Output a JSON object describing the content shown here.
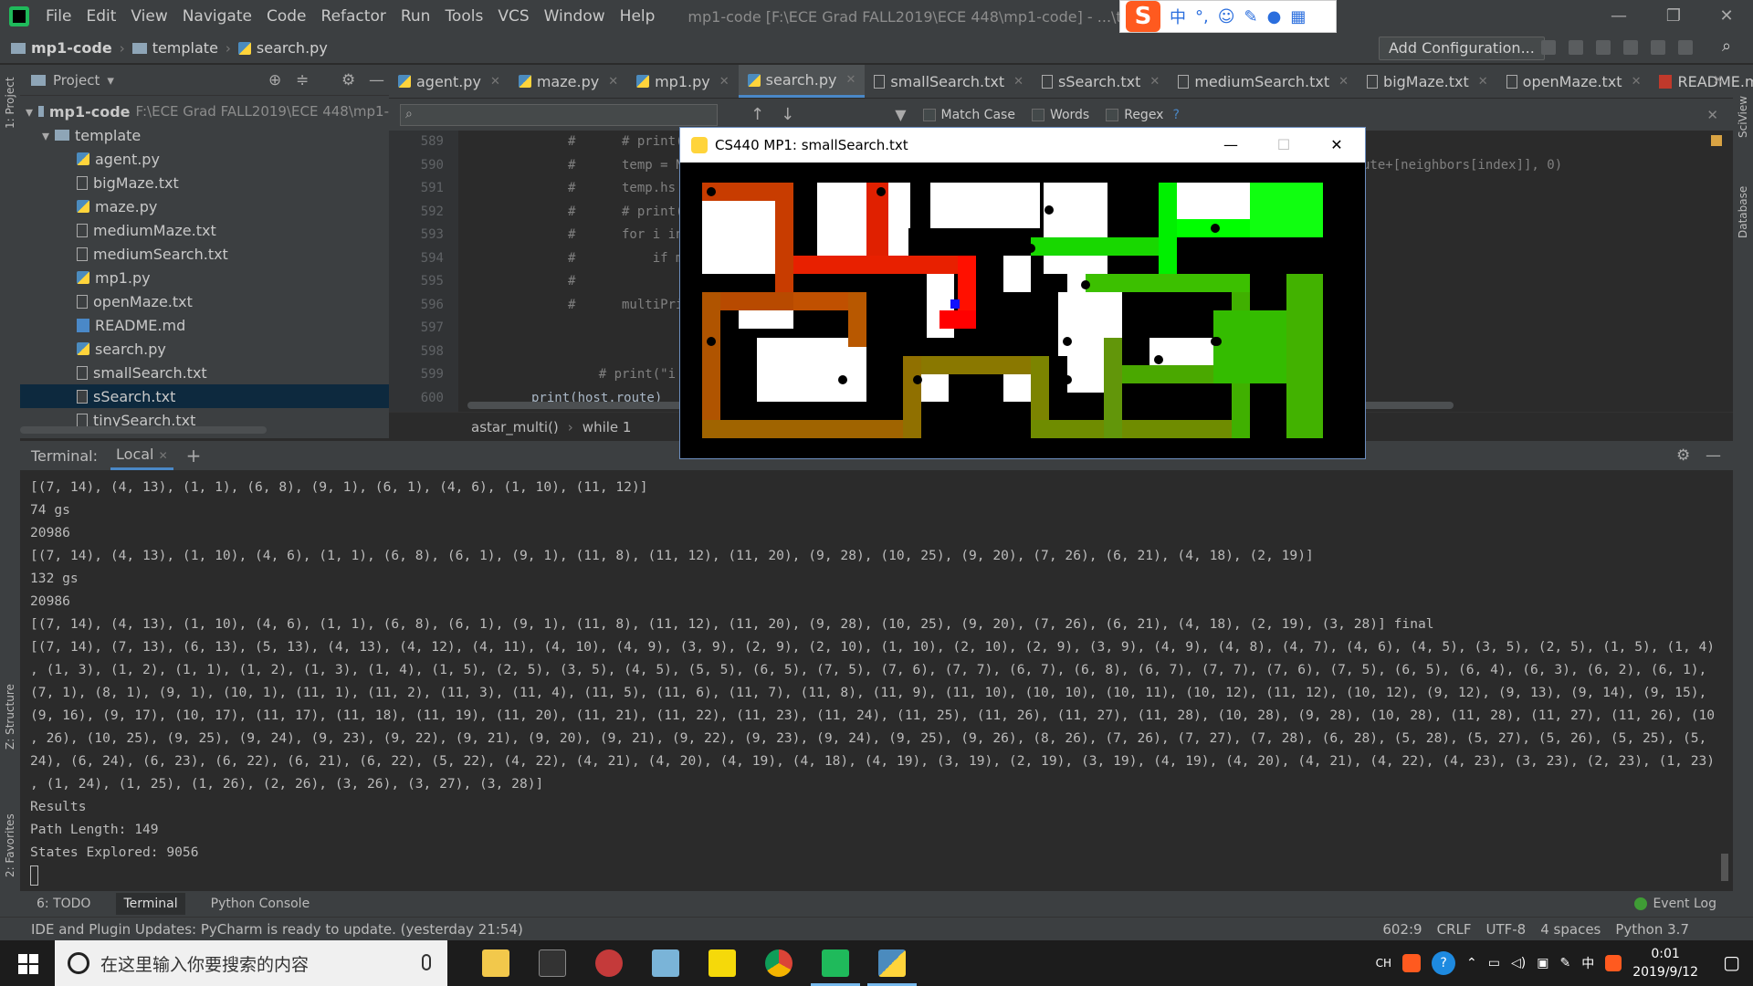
{
  "app": {
    "menu": [
      "File",
      "Edit",
      "View",
      "Navigate",
      "Code",
      "Refactor",
      "Run",
      "Tools",
      "VCS",
      "Window",
      "Help"
    ],
    "window_title": "mp1-code [F:\\ECE Grad FALL2019\\ECE 448\\mp1-code] - ...\\template\\sear"
  },
  "ime": {
    "logo": "S",
    "mode": "中"
  },
  "navbar": {
    "crumbs": [
      "mp1-code",
      "template",
      "search.py"
    ],
    "add_config": "Add Configuration..."
  },
  "project": {
    "title": "Project",
    "root_name": "mp1-code",
    "root_path": "F:\\ECE Grad FALL2019\\ECE 448\\mp1-",
    "folder": "template",
    "files": [
      {
        "name": "agent.py",
        "type": "py"
      },
      {
        "name": "bigMaze.txt",
        "type": "txt"
      },
      {
        "name": "maze.py",
        "type": "py"
      },
      {
        "name": "mediumMaze.txt",
        "type": "txt"
      },
      {
        "name": "mediumSearch.txt",
        "type": "txt"
      },
      {
        "name": "mp1.py",
        "type": "py"
      },
      {
        "name": "openMaze.txt",
        "type": "txt"
      },
      {
        "name": "README.md",
        "type": "md"
      },
      {
        "name": "search.py",
        "type": "py"
      },
      {
        "name": "smallSearch.txt",
        "type": "txt"
      },
      {
        "name": "sSearch.txt",
        "type": "txt",
        "selected": true
      },
      {
        "name": "tinySearch.txt",
        "type": "txt"
      }
    ]
  },
  "tabs": [
    "agent.py",
    "maze.py",
    "mp1.py",
    "search.py",
    "smallSearch.txt",
    "sSearch.txt",
    "mediumSearch.txt",
    "bigMaze.txt",
    "openMaze.txt",
    "README.md"
  ],
  "active_tab": "search.py",
  "find": {
    "match_case": "Match Case",
    "words": "Words",
    "regex": "Regex",
    "help": "?"
  },
  "code": {
    "lines": [
      {
        "n": "589",
        "text": "#      # print("
      },
      {
        "n": "590",
        "text": "#      temp = N"
      },
      {
        "n": "591",
        "text": "#      temp.hs"
      },
      {
        "n": "592",
        "text": "#      # print("
      },
      {
        "n": "593",
        "text": "#      for i in"
      },
      {
        "n": "594",
        "text": "#          if m"
      },
      {
        "n": "595",
        "text": "#"
      },
      {
        "n": "596",
        "text": "#      multiPri"
      },
      {
        "n": "597",
        "text": ""
      },
      {
        "n": "598",
        "text": ""
      },
      {
        "n": "599",
        "text": "    # print(\"i"
      },
      {
        "n": "600",
        "text": "print(host.route)"
      }
    ],
    "right_fragment": "ute+[neighbors[index]], 0)",
    "breadcrumb": [
      "astar_multi()",
      "while 1"
    ]
  },
  "maze_window": {
    "title": "CS440 MP1: smallSearch.txt"
  },
  "terminal": {
    "label": "Terminal:",
    "tab": "Local",
    "lines": [
      "[(7, 14), (4, 13), (1, 1), (6, 8), (9, 1), (6, 1), (4, 6), (1, 10), (11, 12)]",
      "74 gs",
      "20986",
      "[(7, 14), (4, 13), (1, 10), (4, 6), (1, 1), (6, 8), (6, 1), (9, 1), (11, 8), (11, 12), (11, 20), (9, 28), (10, 25), (9, 20), (7, 26), (6, 21), (4, 18), (2, 19)]",
      "132 gs",
      "20986",
      "[(7, 14), (4, 13), (1, 10), (4, 6), (1, 1), (6, 8), (6, 1), (9, 1), (11, 8), (11, 12), (11, 20), (9, 28), (10, 25), (9, 20), (7, 26), (6, 21), (4, 18), (2, 19), (3, 28)] final",
      "[(7, 14), (7, 13), (6, 13), (5, 13), (4, 13), (4, 12), (4, 11), (4, 10), (4, 9), (3, 9), (2, 9), (2, 10), (1, 10), (2, 10), (2, 9), (3, 9), (4, 9), (4, 8), (4, 7), (4, 6), (4, 5), (3, 5), (2, 5), (1, 5), (1, 4)",
      ", (1, 3), (1, 2), (1, 1), (1, 2), (1, 3), (1, 4), (1, 5), (2, 5), (3, 5), (4, 5), (5, 5), (6, 5), (7, 5), (7, 6), (7, 7), (6, 7), (6, 8), (6, 7), (7, 7), (7, 6), (7, 5), (6, 5), (6, 4), (6, 3), (6, 2), (6, 1),",
      "(7, 1), (8, 1), (9, 1), (10, 1), (11, 1), (11, 2), (11, 3), (11, 4), (11, 5), (11, 6), (11, 7), (11, 8), (11, 9), (11, 10), (10, 10), (10, 11), (10, 12), (11, 12), (10, 12), (9, 12), (9, 13), (9, 14), (9, 15),",
      "(9, 16), (9, 17), (10, 17), (11, 17), (11, 18), (11, 19), (11, 20), (11, 21), (11, 22), (11, 23), (11, 24), (11, 25), (11, 26), (11, 27), (11, 28), (10, 28), (9, 28), (10, 28), (11, 28), (11, 27), (11, 26), (10",
      ", 26), (10, 25), (9, 25), (9, 24), (9, 23), (9, 22), (9, 21), (9, 20), (9, 21), (9, 22), (9, 23), (9, 24), (9, 25), (9, 26), (8, 26), (7, 26), (7, 27), (7, 28), (6, 28), (5, 28), (5, 27), (5, 26), (5, 25), (5,",
      "24), (6, 24), (6, 23), (6, 22), (6, 21), (6, 22), (5, 22), (4, 22), (4, 21), (4, 20), (4, 19), (4, 18), (4, 19), (3, 19), (2, 19), (3, 19), (4, 19), (4, 20), (4, 21), (4, 22), (4, 23), (3, 23), (2, 23), (1, 23)",
      ", (1, 24), (1, 25), (1, 26), (2, 26), (3, 26), (3, 27), (3, 28)]",
      "Results",
      "Path Length: 149",
      "States Explored: 9056"
    ]
  },
  "toolwindows": [
    "6: TODO",
    "Terminal",
    "Python Console"
  ],
  "event_log": "Event Log",
  "status": {
    "message": "IDE and Plugin Updates: PyCharm is ready to update. (yesterday 21:54)",
    "position": "602:9",
    "line_sep": "CRLF",
    "encoding": "UTF-8",
    "indent": "4 spaces",
    "interpreter": "Python 3.7"
  },
  "side_labels": {
    "project": "1: Project",
    "structure": "Z: Structure",
    "favorites": "2: Favorites",
    "sciview": "SciView",
    "database": "Database"
  },
  "taskbar": {
    "search_placeholder": "在这里输入你要搜索的内容",
    "tray_lang": "中",
    "time": "0:01",
    "date": "2019/9/12"
  }
}
